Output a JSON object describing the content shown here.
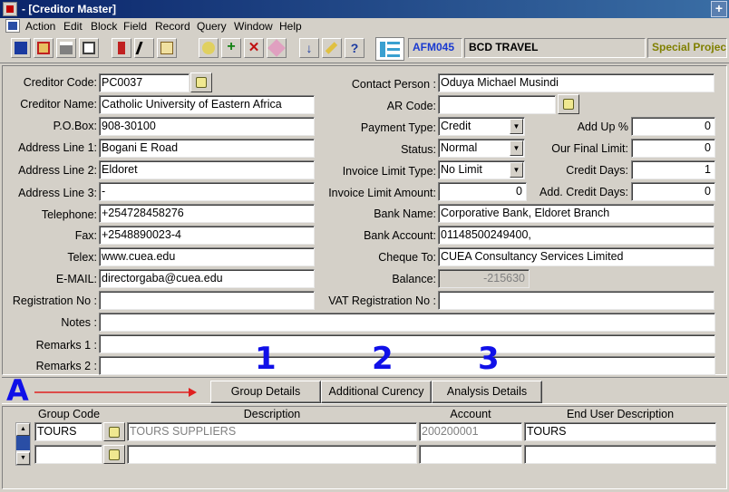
{
  "window": {
    "title": "- [Creditor Master]"
  },
  "menu": [
    "Action",
    "Edit",
    "Block",
    "Field",
    "Record",
    "Query",
    "Window",
    "Help"
  ],
  "toolbar": {
    "form_code": "AFM045",
    "company": "BCD TRAVEL",
    "project": "Special Project"
  },
  "form": {
    "creditor_code_label": "Creditor  Code:",
    "creditor_code": "PC0037",
    "creditor_name_label": "Creditor  Name:",
    "creditor_name": "Catholic University of Eastern Africa",
    "pobox_label": "P.O.Box:",
    "pobox": "908-30100",
    "addr1_label": "Address Line 1:",
    "addr1": "Bogani E Road",
    "addr2_label": "Address Line 2:",
    "addr2": "Eldoret",
    "addr3_label": "Address Line 3:",
    "addr3": "-",
    "telephone_label": "Telephone:",
    "telephone": "+254728458276",
    "fax_label": "Fax:",
    "fax": "+2548890023-4",
    "telex_label": "Telex:",
    "telex": "www.cuea.edu",
    "email_label": "E-MAIL:",
    "email": "directorgaba@cuea.edu",
    "registration_label": "Registration No :",
    "registration": "",
    "notes_label": "Notes :",
    "notes": "",
    "remarks1_label": "Remarks 1 :",
    "remarks1": "",
    "remarks2_label": "Remarks 2 :",
    "remarks2": "",
    "contact_label": "Contact Person :",
    "contact": "Oduya Michael Musindi",
    "ar_code_label": "AR Code:",
    "ar_code": "",
    "payment_type_label": "Payment Type:",
    "payment_type": "Credit",
    "status_label": "Status:",
    "status": "Normal",
    "invoice_limit_type_label": "Invoice Limit Type:",
    "invoice_limit_type": "No Limit",
    "invoice_limit_amount_label": "Invoice Limit Amount:",
    "invoice_limit_amount": "0",
    "bank_name_label": "Bank Name:",
    "bank_name": "Corporative Bank, Eldoret Branch",
    "bank_account_label": "Bank Account:",
    "bank_account": "01148500249400,",
    "cheque_to_label": "Cheque To:",
    "cheque_to": "CUEA Consultancy Services Limited",
    "balance_label": "Balance:",
    "balance": "-215630",
    "vat_label": "VAT Registration No :",
    "vat": "",
    "addup_label": "Add Up %",
    "addup": "0",
    "final_limit_label": "Our Final Limit:",
    "final_limit": "0",
    "credit_days_label": "Credit Days:",
    "credit_days": "1",
    "add_credit_days_label": "Add. Credit Days:",
    "add_credit_days": "0"
  },
  "buttons": {
    "group_details": "Group Details",
    "additional_currency": "Additional Curency",
    "analysis_details": "Analysis Details"
  },
  "annotations": {
    "a": "A",
    "n1": "1",
    "n2": "2",
    "n3": "3"
  },
  "detail": {
    "headers": [
      "Group Code",
      "Description",
      "Account",
      "End User Description"
    ],
    "rows": [
      {
        "group_code": "TOURS",
        "description": "TOURS SUPPLIERS",
        "account": "200200001",
        "end_user": "TOURS"
      },
      {
        "group_code": "",
        "description": "",
        "account": "",
        "end_user": ""
      }
    ]
  },
  "colors": {
    "annotation": "#1010e8",
    "arrow": "#e02020",
    "titlebar": "#0a246a"
  }
}
